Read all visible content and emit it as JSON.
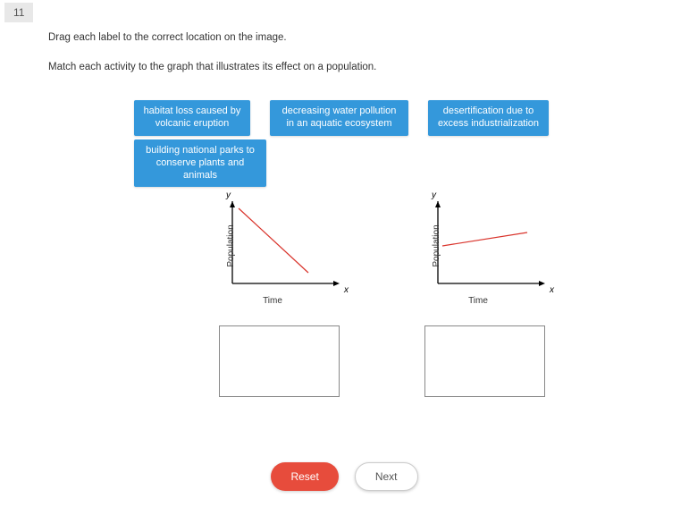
{
  "question_number": "11",
  "instructions": "Drag each label to the correct location on the image.",
  "subinstructions": "Match each activity to the graph that illustrates its effect on a population.",
  "labels": {
    "l1": "habitat loss caused by volcanic eruption",
    "l2": "decreasing water pollution in an aquatic ecosystem",
    "l3": "desertification due to excess industrialization",
    "l4": "building national parks to conserve plants and animals"
  },
  "axes": {
    "ylabel": "Population",
    "xlabel": "Time",
    "yvar": "y",
    "xvar": "x"
  },
  "buttons": {
    "reset": "Reset",
    "next": "Next"
  },
  "chart_data": [
    {
      "type": "line",
      "title": "",
      "xlabel": "Time",
      "ylabel": "Population",
      "series": [
        {
          "name": "population",
          "x": [
            0,
            10
          ],
          "y": [
            9,
            1
          ]
        }
      ],
      "xlim": [
        0,
        10
      ],
      "ylim": [
        0,
        10
      ],
      "trend": "steep_decrease"
    },
    {
      "type": "line",
      "title": "",
      "xlabel": "Time",
      "ylabel": "Population",
      "series": [
        {
          "name": "population",
          "x": [
            0,
            10
          ],
          "y": [
            5,
            6.5
          ]
        }
      ],
      "xlim": [
        0,
        10
      ],
      "ylim": [
        0,
        10
      ],
      "trend": "slight_increase"
    }
  ]
}
